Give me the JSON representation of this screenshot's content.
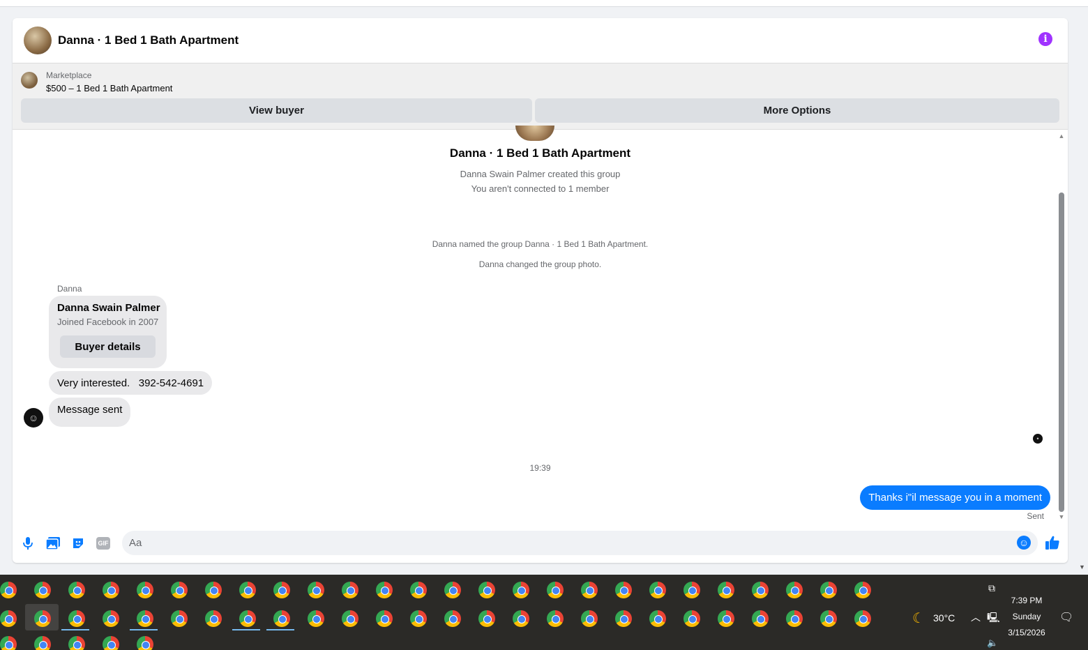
{
  "colors": {
    "accent": "#0a7cff",
    "info": "#a033ff",
    "bubble_in": "#e9e9eb",
    "taskbar": "#2b2a27"
  },
  "header": {
    "title": "Danna · 1 Bed 1 Bath Apartment",
    "info_icon": "info-icon"
  },
  "marketplace": {
    "label": "Marketplace",
    "item": "$500 – 1 Bed 1 Bath Apartment",
    "view_buyer": "View buyer",
    "more_options": "More Options"
  },
  "thread": {
    "group_name": "Danna · 1 Bed 1 Bath Apartment",
    "created": "Danna Swain Palmer created this group",
    "not_connected": "You aren't connected to 1 member",
    "system_1": "Danna named the group Danna · 1 Bed 1 Bath Apartment.",
    "system_2": "Danna changed the group photo.",
    "sender": "Danna",
    "card": {
      "name": "Danna Swain Palmer",
      "sub": "Joined Facebook in 2007",
      "button": "Buyer details"
    },
    "msg_1": "Very interested.   392-542-4691",
    "msg_2": "Message sent",
    "timestamp": "19:39",
    "outgoing": "Thanks i\"il message you in a moment",
    "status": "Sent"
  },
  "composer": {
    "placeholder": "Aa",
    "gif_label": "GIF",
    "icons": [
      "microphone-icon",
      "photo-icon",
      "sticker-icon",
      "gif-icon",
      "emoji-icon",
      "thumbs-up-icon"
    ]
  },
  "tray": {
    "temperature": "30°C",
    "time": "7:39 PM",
    "day": "Sunday",
    "date": "3/15/2026"
  }
}
